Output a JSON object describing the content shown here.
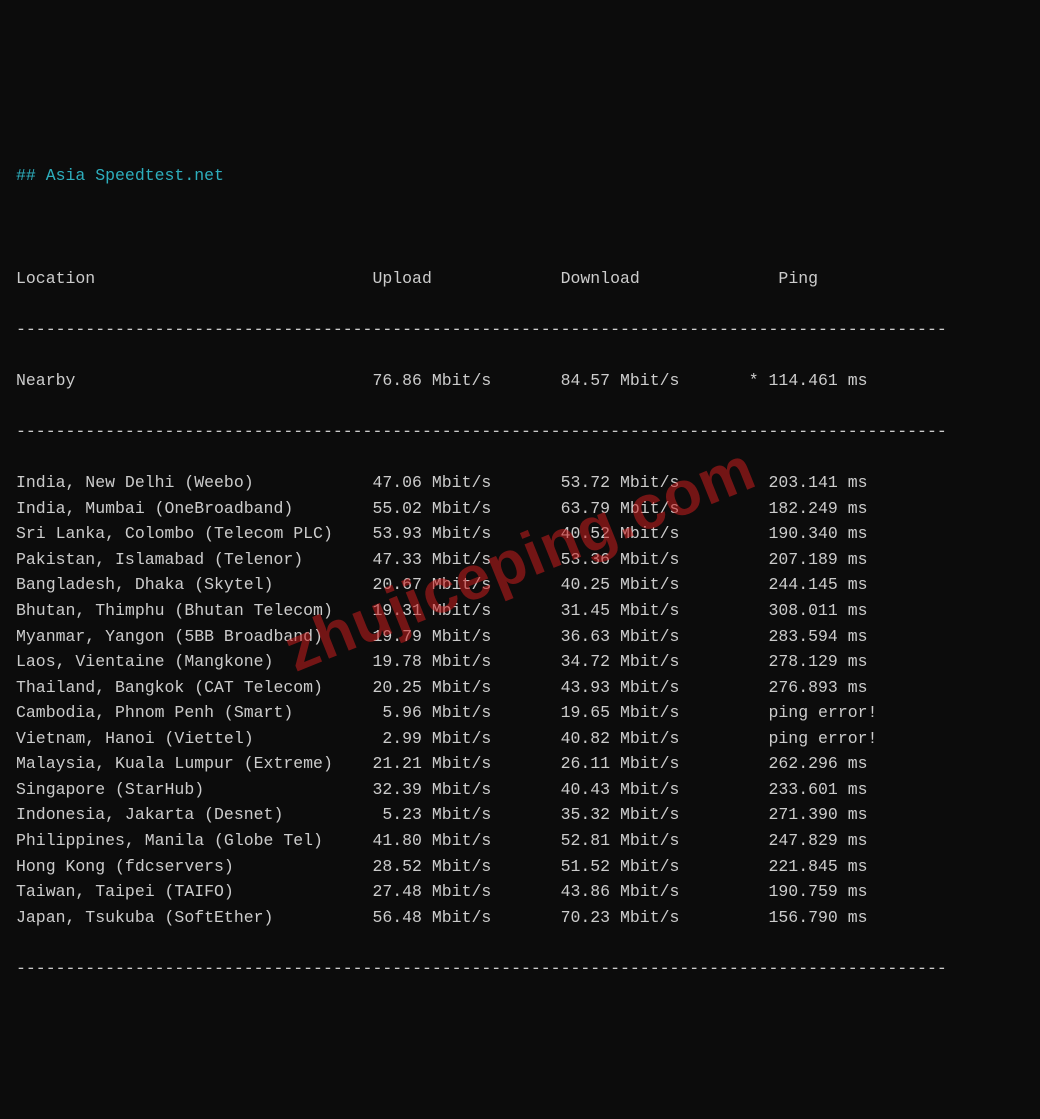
{
  "title": "## Asia Speedtest.net",
  "columns": {
    "location": "Location",
    "upload": "Upload",
    "download": "Download",
    "ping": "Ping"
  },
  "dash_line": "----------------------------------------------------------------------------------------------",
  "speed_unit": "Mbit/s",
  "ping_unit": "ms",
  "ping_error": "ping error!",
  "nearby": {
    "location": "Nearby",
    "upload": "76.86",
    "download": "84.57",
    "ping": "114.461",
    "ping_prefix": "* "
  },
  "rows": [
    {
      "location": "India, New Delhi (Weebo)",
      "upload": "47.06",
      "download": "53.72",
      "ping": "203.141"
    },
    {
      "location": "India, Mumbai (OneBroadband)",
      "upload": "55.02",
      "download": "63.79",
      "ping": "182.249"
    },
    {
      "location": "Sri Lanka, Colombo (Telecom PLC)",
      "upload": "53.93",
      "download": "40.52",
      "ping": "190.340"
    },
    {
      "location": "Pakistan, Islamabad (Telenor)",
      "upload": "47.33",
      "download": "53.36",
      "ping": "207.189"
    },
    {
      "location": "Bangladesh, Dhaka (Skytel)",
      "upload": "20.67",
      "download": "40.25",
      "ping": "244.145"
    },
    {
      "location": "Bhutan, Thimphu (Bhutan Telecom)",
      "upload": "19.31",
      "download": "31.45",
      "ping": "308.011"
    },
    {
      "location": "Myanmar, Yangon (5BB Broadband)",
      "upload": "19.79",
      "download": "36.63",
      "ping": "283.594"
    },
    {
      "location": "Laos, Vientaine (Mangkone)",
      "upload": "19.78",
      "download": "34.72",
      "ping": "278.129"
    },
    {
      "location": "Thailand, Bangkok (CAT Telecom)",
      "upload": "20.25",
      "download": "43.93",
      "ping": "276.893"
    },
    {
      "location": "Cambodia, Phnom Penh (Smart)",
      "upload": "5.96",
      "download": "19.65",
      "ping": null
    },
    {
      "location": "Vietnam, Hanoi (Viettel)",
      "upload": "2.99",
      "download": "40.82",
      "ping": null
    },
    {
      "location": "Malaysia, Kuala Lumpur (Extreme)",
      "upload": "21.21",
      "download": "26.11",
      "ping": "262.296"
    },
    {
      "location": "Singapore (StarHub)",
      "upload": "32.39",
      "download": "40.43",
      "ping": "233.601"
    },
    {
      "location": "Indonesia, Jakarta (Desnet)",
      "upload": "5.23",
      "download": "35.32",
      "ping": "271.390"
    },
    {
      "location": "Philippines, Manila (Globe Tel)",
      "upload": "41.80",
      "download": "52.81",
      "ping": "247.829"
    },
    {
      "location": "Hong Kong (fdcservers)",
      "upload": "28.52",
      "download": "51.52",
      "ping": "221.845"
    },
    {
      "location": "Taiwan, Taipei (TAIFO)",
      "upload": "27.48",
      "download": "43.86",
      "ping": "190.759"
    },
    {
      "location": "Japan, Tsukuba (SoftEther)",
      "upload": "56.48",
      "download": "70.23",
      "ping": "156.790"
    }
  ],
  "watermark": "zhujiceping.com"
}
